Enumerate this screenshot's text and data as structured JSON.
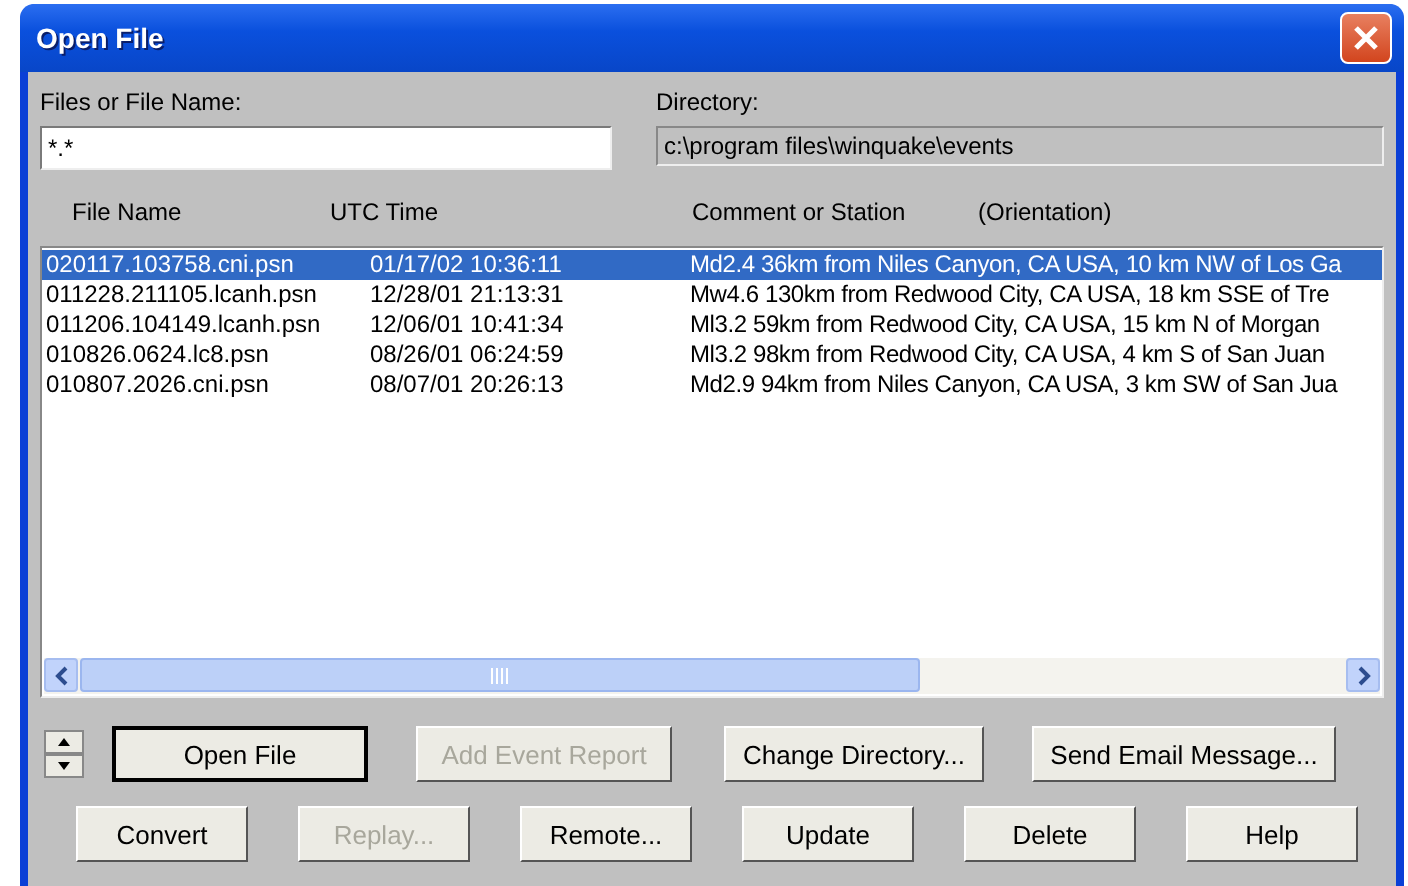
{
  "window": {
    "title": "Open File"
  },
  "file_name": {
    "label": "Files or File Name:",
    "value": "*.*"
  },
  "directory": {
    "label": "Directory:",
    "value": "c:\\program files\\winquake\\events"
  },
  "columns": [
    "File Name",
    "UTC Time",
    "Comment or Station",
    "(Orientation)"
  ],
  "rows": [
    {
      "file": "020117.103758.cni.psn",
      "time": "01/17/02 10:36:11",
      "comment": "Md2.4 36km from Niles Canyon, CA USA, 10 km NW of Los Ga",
      "selected": true
    },
    {
      "file": "011228.211105.lcanh.psn",
      "time": "12/28/01 21:13:31",
      "comment": "Mw4.6 130km from Redwood City, CA USA, 18 km SSE of Tre",
      "selected": false
    },
    {
      "file": "011206.104149.lcanh.psn",
      "time": "12/06/01 10:41:34",
      "comment": "Ml3.2 59km from Redwood City, CA USA, 15 km N of Morgan",
      "selected": false
    },
    {
      "file": "010826.0624.lc8.psn",
      "time": "08/26/01 06:24:59",
      "comment": "Ml3.2 98km from Redwood City, CA USA, 4 km S of San Juan",
      "selected": false
    },
    {
      "file": "010807.2026.cni.psn",
      "time": "08/07/01 20:26:13",
      "comment": "Md2.9 94km from Niles Canyon, CA USA, 3 km SW of San Jua",
      "selected": false
    }
  ],
  "buttons_row_1": [
    {
      "label": "Open File",
      "disabled": false,
      "default": true
    },
    {
      "label": "Add Event Report",
      "disabled": true,
      "default": false
    },
    {
      "label": "Change Directory...",
      "disabled": false,
      "default": false
    },
    {
      "label": "Send Email Message...",
      "disabled": false,
      "default": false
    }
  ],
  "buttons_row_2": [
    {
      "label": "Convert",
      "disabled": false
    },
    {
      "label": "Replay...",
      "disabled": true
    },
    {
      "label": "Remote...",
      "disabled": false
    },
    {
      "label": "Update",
      "disabled": false
    },
    {
      "label": "Delete",
      "disabled": false
    },
    {
      "label": "Help",
      "disabled": false
    }
  ]
}
